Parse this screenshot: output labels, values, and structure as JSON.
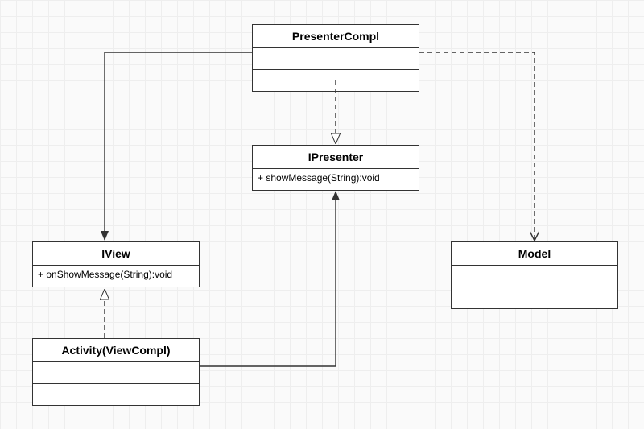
{
  "diagram": {
    "type": "uml-class",
    "classes": {
      "presenterCompl": {
        "name": "PresenterCompl",
        "attributes": "",
        "methods": ""
      },
      "ipresenter": {
        "name": "IPresenter",
        "attributes": "",
        "methods": "+ showMessage(String):void"
      },
      "iview": {
        "name": "IView",
        "attributes": "",
        "methods": "+ onShowMessage(String):void"
      },
      "activity": {
        "name": "Activity(ViewCompl)",
        "attributes": "",
        "methods": ""
      },
      "model": {
        "name": "Model",
        "attributes": "",
        "methods": ""
      }
    },
    "relationships": [
      {
        "from": "presenterCompl",
        "to": "ipresenter",
        "type": "realization"
      },
      {
        "from": "presenterCompl",
        "to": "iview",
        "type": "association"
      },
      {
        "from": "presenterCompl",
        "to": "model",
        "type": "dependency"
      },
      {
        "from": "activity",
        "to": "iview",
        "type": "realization"
      },
      {
        "from": "activity",
        "to": "ipresenter",
        "type": "association"
      }
    ]
  }
}
